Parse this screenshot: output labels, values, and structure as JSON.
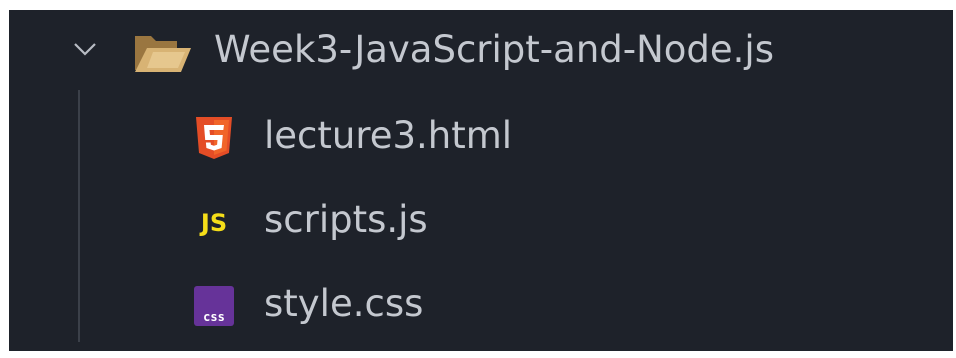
{
  "explorer": {
    "folder": {
      "name": "Week3-JavaScript-and-Node.js",
      "expanded": true,
      "icon": "folder-open-icon",
      "icon_color": "#c09553"
    },
    "files": [
      {
        "name": "lecture3.html",
        "icon": "html5-icon",
        "icon_color": "#e44d26"
      },
      {
        "name": "scripts.js",
        "icon": "js-icon",
        "icon_color": "#f5de19",
        "icon_text": "JS"
      },
      {
        "name": "style.css",
        "icon": "css-icon",
        "icon_color": "#663399",
        "icon_text": "css"
      }
    ]
  }
}
